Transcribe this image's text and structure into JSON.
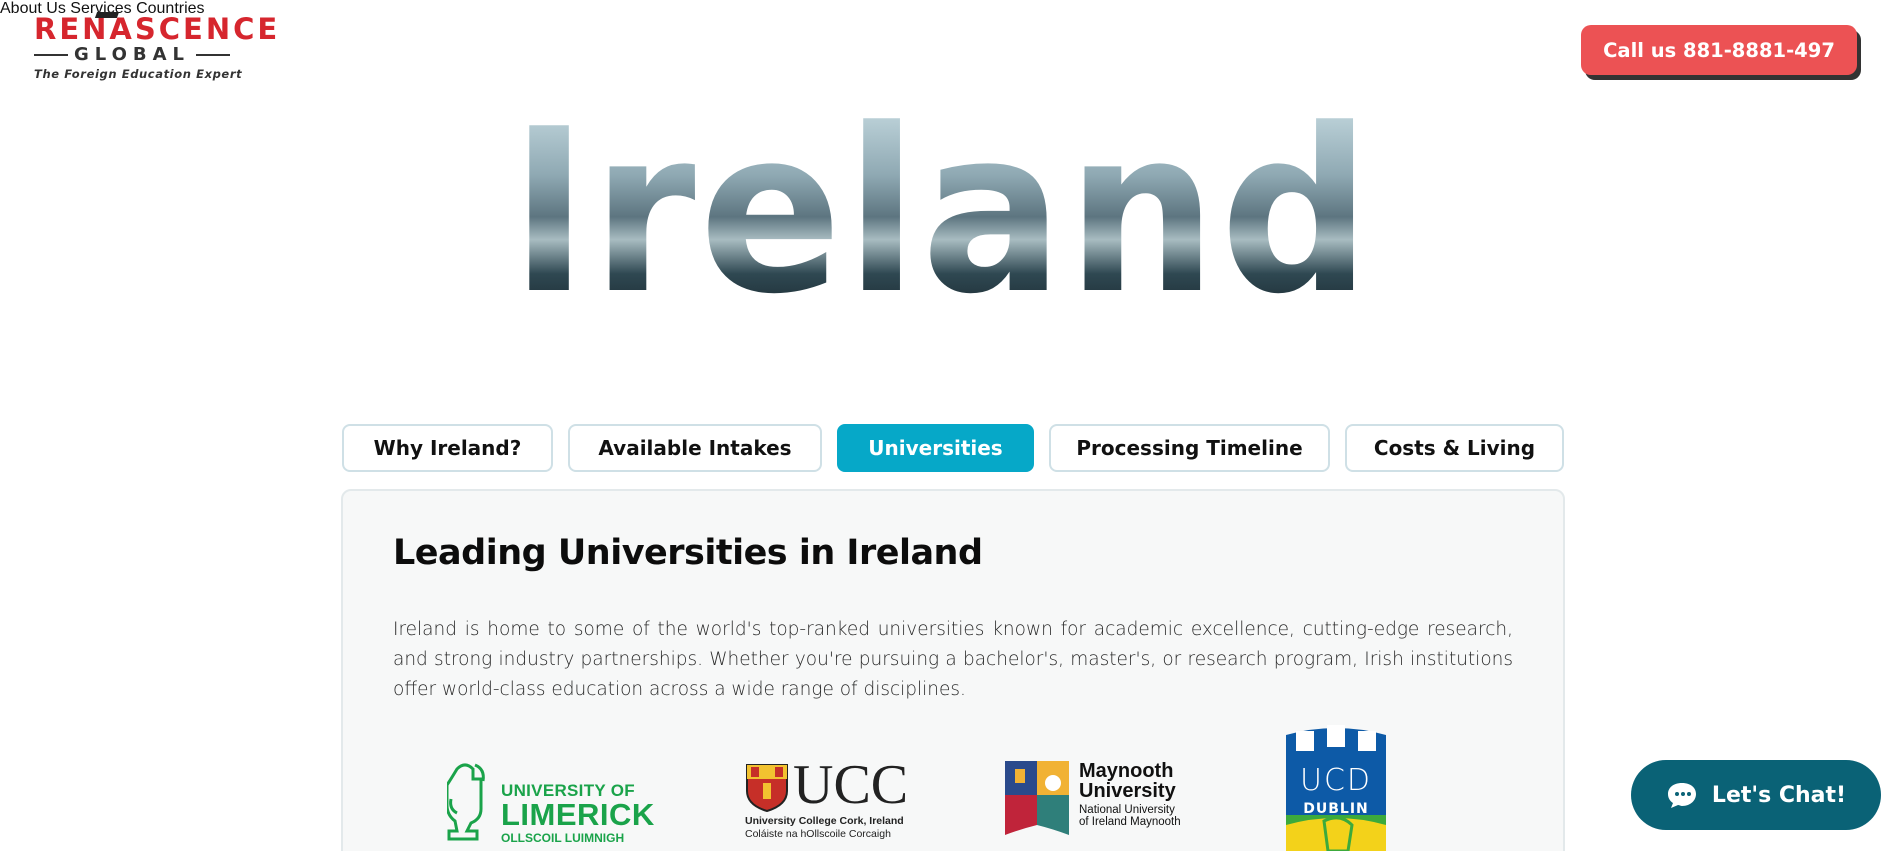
{
  "header": {
    "logo": {
      "top": "RENASCENCE",
      "middle": "GLOBAL",
      "tagline": "The Foreign Education Expert"
    },
    "nav": [
      {
        "label": "About Us"
      },
      {
        "label": "Services"
      },
      {
        "label": "Countries"
      }
    ],
    "cta": {
      "label": "Call us 881-8881-497"
    }
  },
  "hero": {
    "title": "Ireland"
  },
  "tabs": [
    {
      "label": "Why Ireland?",
      "active": false
    },
    {
      "label": "Available Intakes",
      "active": false
    },
    {
      "label": "Universities",
      "active": true
    },
    {
      "label": "Processing Timeline",
      "active": false
    },
    {
      "label": "Costs & Living",
      "active": false
    }
  ],
  "panel": {
    "title": "Leading Universities in Ireland",
    "body": "Ireland is home to some of the world's top-ranked universities known for academic excellence, cutting-edge research, and strong industry partnerships. Whether you're pursuing a bachelor's, master's, or research program, Irish institutions offer world-class education across a wide range of disciplines."
  },
  "universities": [
    {
      "line1": "UNIVERSITY OF",
      "line2": "LIMERICK",
      "line3": "OLLSCOIL LUIMNIGH",
      "color": "#1aa34a"
    },
    {
      "line1": "UCC",
      "line2": "University College Cork, Ireland",
      "line3": "Coláiste na hOllscoile Corcaigh",
      "color": "#222222"
    },
    {
      "line1": "Maynooth",
      "line2": "University",
      "line3": "National University",
      "line4": "of Ireland Maynooth",
      "color": "#111111"
    },
    {
      "line1": "UCD",
      "line2": "DUBLIN",
      "color": "#0d5aa7"
    }
  ],
  "chat": {
    "label": "Let's Chat!"
  },
  "colors": {
    "brand_red": "#d6262e",
    "cta_red": "#ec5254",
    "active_tab": "#06a8c8",
    "chat_bg": "#0a6276"
  }
}
